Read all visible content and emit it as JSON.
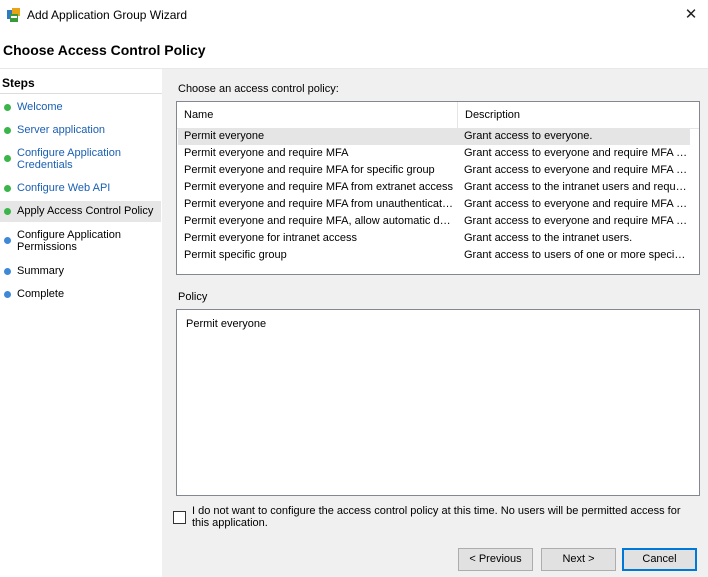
{
  "window": {
    "title": "Add Application Group Wizard",
    "close_glyph": "✕"
  },
  "page": {
    "heading": "Choose Access Control Policy"
  },
  "steps": {
    "title": "Steps",
    "items": [
      {
        "label": "Welcome",
        "state": "done"
      },
      {
        "label": "Server application",
        "state": "done"
      },
      {
        "label": "Configure Application Credentials",
        "state": "done"
      },
      {
        "label": "Configure Web API",
        "state": "done"
      },
      {
        "label": "Apply Access Control Policy",
        "state": "current"
      },
      {
        "label": "Configure Application Permissions",
        "state": "pending"
      },
      {
        "label": "Summary",
        "state": "pending"
      },
      {
        "label": "Complete",
        "state": "pending"
      }
    ]
  },
  "policy_list": {
    "label": "Choose an access control policy:",
    "columns": {
      "name": "Name",
      "description": "Description"
    },
    "rows": [
      {
        "name": "Permit everyone",
        "description": "Grant access to everyone.",
        "selected": true
      },
      {
        "name": "Permit everyone and require MFA",
        "description": "Grant access to everyone and require MFA f..."
      },
      {
        "name": "Permit everyone and require MFA for specific group",
        "description": "Grant access to everyone and require MFA f..."
      },
      {
        "name": "Permit everyone and require MFA from extranet access",
        "description": "Grant access to the intranet users and requir..."
      },
      {
        "name": "Permit everyone and require MFA from unauthenticated ...",
        "description": "Grant access to everyone and require MFA f..."
      },
      {
        "name": "Permit everyone and require MFA, allow automatic devi...",
        "description": "Grant access to everyone and require MFA f..."
      },
      {
        "name": "Permit everyone for intranet access",
        "description": "Grant access to the intranet users."
      },
      {
        "name": "Permit specific group",
        "description": "Grant access to users of one or more specifi..."
      }
    ]
  },
  "policy": {
    "label": "Policy",
    "text": "Permit everyone"
  },
  "skip_option": {
    "label": "I do not want to configure the access control policy at this time.  No users will be permitted access for this application.",
    "checked": false
  },
  "buttons": {
    "previous": "< Previous",
    "next": "Next >",
    "cancel": "Cancel"
  },
  "colors": {
    "step_done_dot": "#39b54a",
    "step_pending_dot": "#3f88d8",
    "link_text": "#1a5fb4",
    "accent_border": "#0078d7",
    "content_background": "#f0f0f0"
  }
}
